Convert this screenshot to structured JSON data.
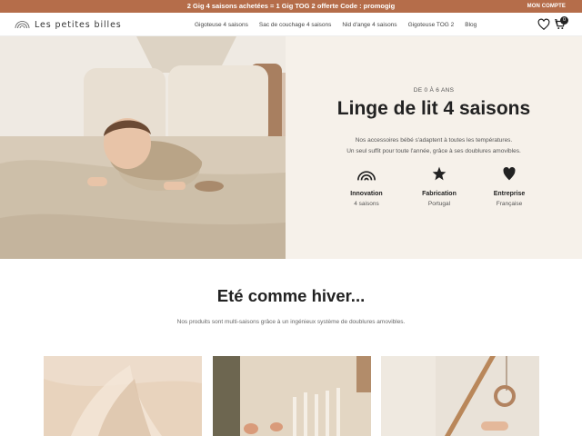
{
  "announcement": {
    "promo_text": "2 Gig 4 saisons achetées = 1 Gig TOG 2 offerte Code : promogig",
    "account_label": "MON COMPTE"
  },
  "header": {
    "logo_text": "Les petites billes",
    "nav": [
      "Gigoteuse 4 saisons",
      "Sac de couchage 4 saisons",
      "Nid d'ange 4 saisons",
      "Gigoteuse TOG 2",
      "Blog"
    ],
    "cart_count": "0"
  },
  "hero": {
    "eyebrow": "DE 0 À 6 ANS",
    "title": "Linge de lit 4 saisons",
    "description_line1": "Nos accessoires bébé s'adaptent à toutes les températures.",
    "description_line2": "Un seul suffit pour toute l'année, grâce à ses doublures amovibles.",
    "features": [
      {
        "icon": "rainbow-icon",
        "title": "Innovation",
        "subtitle": "4 saisons"
      },
      {
        "icon": "star-icon",
        "title": "Fabrication",
        "subtitle": "Portugal"
      },
      {
        "icon": "heart-icon",
        "title": "Entreprise",
        "subtitle": "Française"
      }
    ]
  },
  "section": {
    "title": "Eté comme hiver...",
    "description": "Nos produits sont multi-saisons grâce à un ingénieux système de doublures amovibles."
  },
  "colors": {
    "announcement_bg": "#b56d4a",
    "hero_panel_bg": "#f6f1ea",
    "text_dark": "#222222"
  }
}
